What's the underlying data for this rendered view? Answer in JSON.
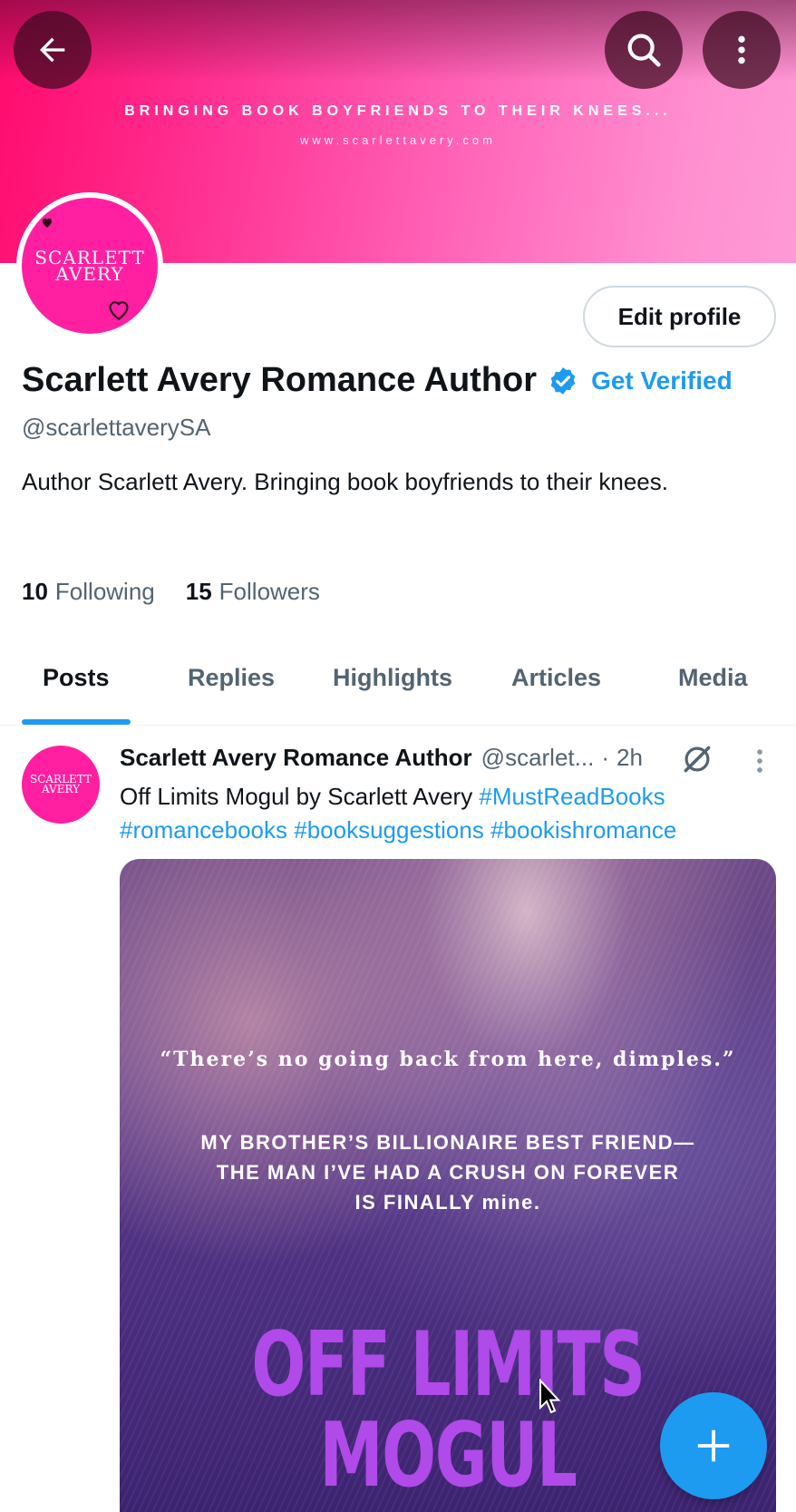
{
  "header": {
    "back_icon": "arrow-left-icon",
    "search_icon": "search-icon",
    "more_icon": "more-vertical-icon"
  },
  "banner": {
    "tagline": "BRINGING BOOK BOYFRIENDS TO THEIR KNEES...",
    "url": "www.scarlettavery.com",
    "colors": [
      "#ff0a6c",
      "#ff9ad6"
    ]
  },
  "profile": {
    "avatar_text_line1": "SCARLETT",
    "avatar_text_line2": "AVERY",
    "edit_profile_label": "Edit profile",
    "display_name": "Scarlett Avery Romance Author",
    "get_verified_label": "Get Verified",
    "handle": "@scarlettaverySA",
    "bio": "Author Scarlett Avery. Bringing book boyfriends to their knees.",
    "following_count": "10",
    "following_label": "Following",
    "followers_count": "15",
    "followers_label": "Followers"
  },
  "tabs": [
    "Posts",
    "Replies",
    "Highlights",
    "Articles",
    "Media"
  ],
  "active_tab": "Posts",
  "post": {
    "author": "Scarlett Avery Romance Author",
    "handle": "@scarlet...",
    "separator": "·",
    "time": "2h",
    "text": "Off Limits Mogul by Scarlett Avery",
    "hashtags": [
      "#MustReadBooks",
      "#romancebooks",
      "#booksuggestions",
      "#bookishromance"
    ],
    "media": {
      "quote": "“There’s no going back from here, dimples.”",
      "line1": "MY BROTHER’S BILLIONAIRE BEST FRIEND—",
      "line2": "THE MAN I’VE HAD A CRUSH ON FOREVER",
      "line3": "IS FINALLY mine.",
      "title_line1": "OFF LIMITS",
      "title_line2": "MOGUL"
    }
  },
  "fab_icon": "plus-icon",
  "colors": {
    "accent": "#1d9bf0",
    "text_primary": "#0f1419",
    "text_secondary": "#536471"
  }
}
